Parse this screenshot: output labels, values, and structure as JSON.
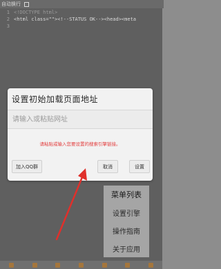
{
  "topbar": {
    "auto_wrap_label": "自动换行"
  },
  "code_lines": [
    {
      "num": "1",
      "text": "<!DOCTYPE html>"
    },
    {
      "num": "2",
      "text": "<html class=\"\"><!--STATUS OK--><head><meta"
    },
    {
      "num": "3",
      "text": ""
    }
  ],
  "dialog": {
    "title": "设置初始加载页面地址",
    "input_placeholder": "请输入或粘贴网址",
    "input_value": "",
    "hint": "请粘贴或输入您要设置的搜索引擎链接。",
    "qq_button": "加入QQ群",
    "cancel_button": "取消",
    "settings_button": "设置"
  },
  "menu": {
    "title": "菜单列表",
    "items": [
      "设置引擎",
      "操作指南",
      "关于应用"
    ]
  },
  "colors": {
    "hint_red": "#e23b3b",
    "annotation_arrow": "#e0302b"
  }
}
